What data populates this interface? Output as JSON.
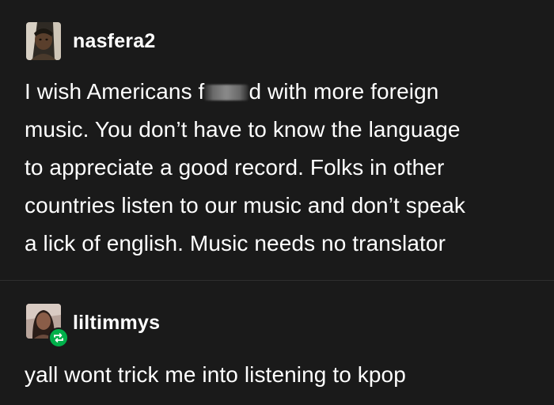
{
  "posts": [
    {
      "username": "nasfera2",
      "avatar_icon": "user-avatar-icon",
      "lines": [
        {
          "before": "I wish Americans f",
          "censored": true,
          "after": "d with more foreign"
        },
        {
          "text": "music. You don’t have to know the language"
        },
        {
          "text": "to appreciate a good record. Folks in other"
        },
        {
          "text": "countries listen to our music and don’t speak"
        },
        {
          "text": "a lick of english. Music needs no translator"
        }
      ]
    },
    {
      "username": "liltimmys",
      "avatar_icon": "user-avatar-icon",
      "badge_icon": "reblog-icon",
      "badge_color": "#00b04a",
      "text": "yall wont trick me into listening to kpop"
    }
  ],
  "colors": {
    "background": "#1a1a1a",
    "text": "#ffffff",
    "divider": "#2e2e2e"
  }
}
